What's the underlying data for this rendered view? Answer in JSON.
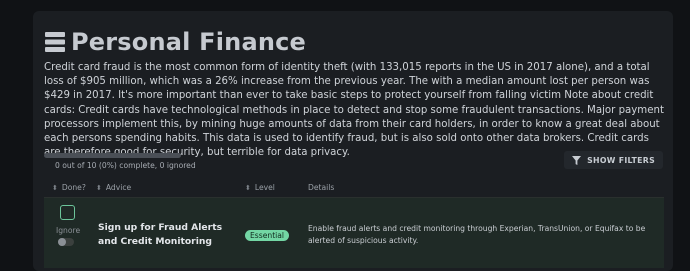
{
  "page": {
    "title": "Personal Finance",
    "title_icon": "list-icon",
    "description": "Credit card fraud is the most common form of identity theft (with 133,015 reports in the US in 2017 alone), and a total loss of $905 million, which was a 26% increase from the previous year. The with a median amount lost per person was $429 in 2017. It's more important than ever to take basic steps to protect yourself from falling victim Note about credit cards: Credit cards have technological methods in place to detect and stop some fraudulent transactions. Major payment processors implement this, by mining huge amounts of data from their card holders, in order to know a great deal about each persons spending habits. This data is used to identify fraud, but is also sold onto other data brokers. Credit cards are therefore good for security, but terrible for data privacy."
  },
  "progress": {
    "text": "0 out of 10 (0%) complete, 0 ignored",
    "fraction": 0
  },
  "toolbar": {
    "filters_label": "SHOW FILTERS",
    "filters_icon": "filter-icon"
  },
  "table": {
    "columns": {
      "done": "Done?",
      "advice": "Advice",
      "level": "Level",
      "details": "Details"
    },
    "rows": [
      {
        "done": false,
        "ignore_label": "Ignore",
        "ignored": false,
        "advice": "Sign up for Fraud Alerts and Credit Monitoring",
        "level": "Essential",
        "details": "Enable fraud alerts and credit monitoring through Experian, TransUnion, or Equifax to be alerted of suspicious activity."
      }
    ]
  },
  "colors": {
    "accent_green": "#6cc59a",
    "badge_green": "#73d6a4",
    "background": "#101215",
    "card": "#1b1e22",
    "row": "#1f2a26"
  }
}
